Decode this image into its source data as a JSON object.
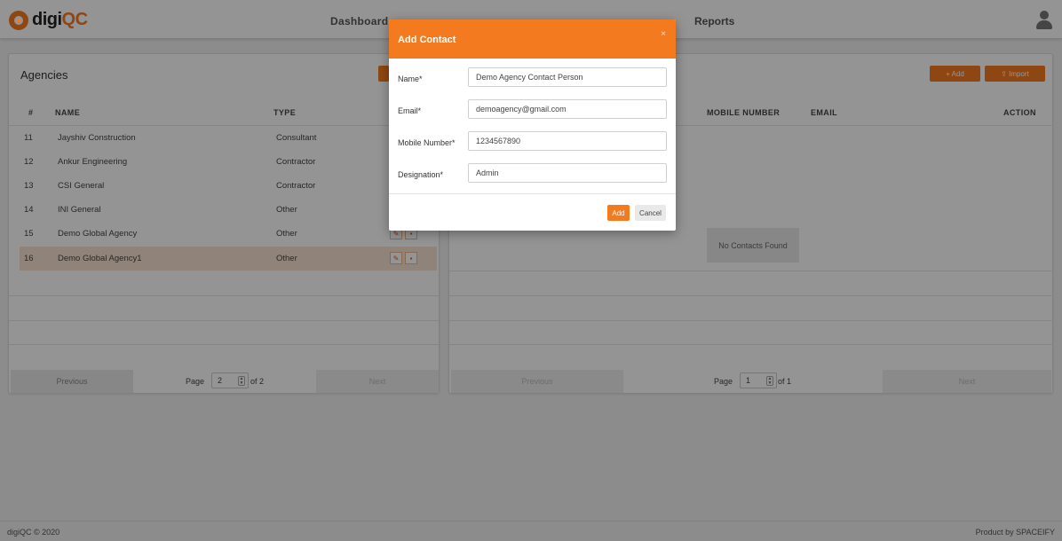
{
  "brand": {
    "name_prefix": "digi",
    "name_suffix": "QC",
    "accent": "#f47a20"
  },
  "nav": {
    "items": [
      {
        "label": "Dashboard"
      }
    ],
    "reports_label": "Reports",
    "user_icon": "user-icon"
  },
  "agencies": {
    "title": "Agencies",
    "columns": {
      "index": "#",
      "name": "NAME",
      "type": "TYPE"
    },
    "rows": [
      {
        "index": "11",
        "name": "Jayshiv Construction",
        "type": "Consultant"
      },
      {
        "index": "12",
        "name": "Ankur Engineering",
        "type": "Contractor"
      },
      {
        "index": "13",
        "name": "CSI General",
        "type": "Contractor"
      },
      {
        "index": "14",
        "name": "INI General",
        "type": "Other"
      },
      {
        "index": "15",
        "name": "Demo Global Agency",
        "type": "Other"
      },
      {
        "index": "16",
        "name": "Demo Global Agency1",
        "type": "Other"
      }
    ],
    "pager": {
      "previous": "Previous",
      "page_label": "Page",
      "page": "2",
      "of": "of 2",
      "next": "Next"
    }
  },
  "contacts": {
    "add_label": "+ Add",
    "import_label": "⇪ Import",
    "columns": {
      "mobile": "MOBILE NUMBER",
      "email": "EMAIL",
      "action": "ACTION"
    },
    "empty_message": "No Contacts Found",
    "pager": {
      "previous": "Previous",
      "page_label": "Page",
      "page": "1",
      "of": "of 1",
      "next": "Next"
    }
  },
  "modal": {
    "title": "Add Contact",
    "close": "×",
    "fields": {
      "name": {
        "label": "Name*",
        "value": "Demo Agency Contact Person"
      },
      "email": {
        "label": "Email*",
        "value": "demoagency@gmail.com"
      },
      "mobile": {
        "label": "Mobile Number*",
        "value": "1234567890"
      },
      "designation": {
        "label": "Designation*",
        "value": "Admin"
      }
    },
    "add_label": "Add",
    "cancel_label": "Cancel"
  },
  "footer": {
    "copyright": "digiQC © 2020",
    "product": "Product by SPACEIFY"
  }
}
